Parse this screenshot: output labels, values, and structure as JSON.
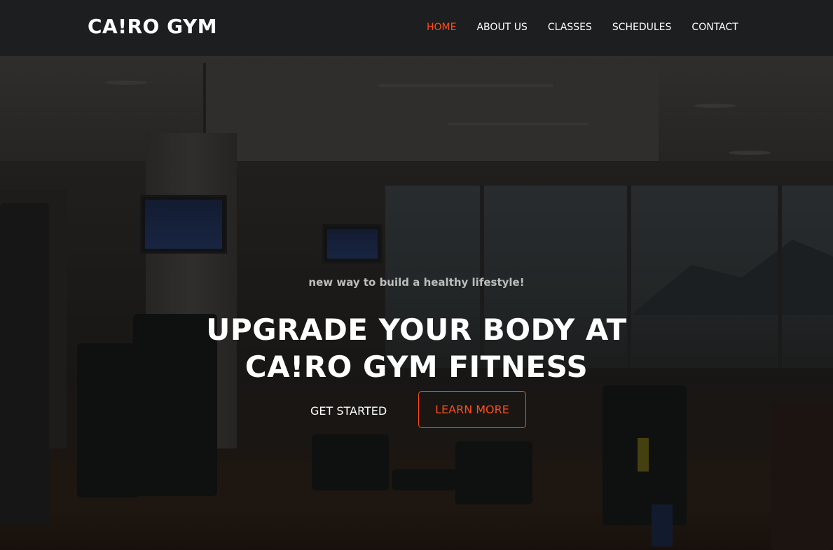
{
  "brand": {
    "logo": "CA!RO GYM"
  },
  "nav": {
    "items": [
      {
        "label": "HOME",
        "active": true
      },
      {
        "label": "ABOUT US",
        "active": false
      },
      {
        "label": "CLASSES",
        "active": false
      },
      {
        "label": "SCHEDULES",
        "active": false
      },
      {
        "label": "CONTACT",
        "active": false
      }
    ]
  },
  "hero": {
    "tagline": "new way to build a healthy lifestyle!",
    "headline_line1": "UPGRADE YOUR BODY AT",
    "headline_line2": "CA!RO GYM FITNESS",
    "primary_button": "GET STARTED",
    "secondary_button": "LEARN MORE",
    "background_image": "gym-interior-photo"
  },
  "colors": {
    "accent": "#ff4e17",
    "navbar_bg": "#1d1e20",
    "text": "#ffffff"
  }
}
